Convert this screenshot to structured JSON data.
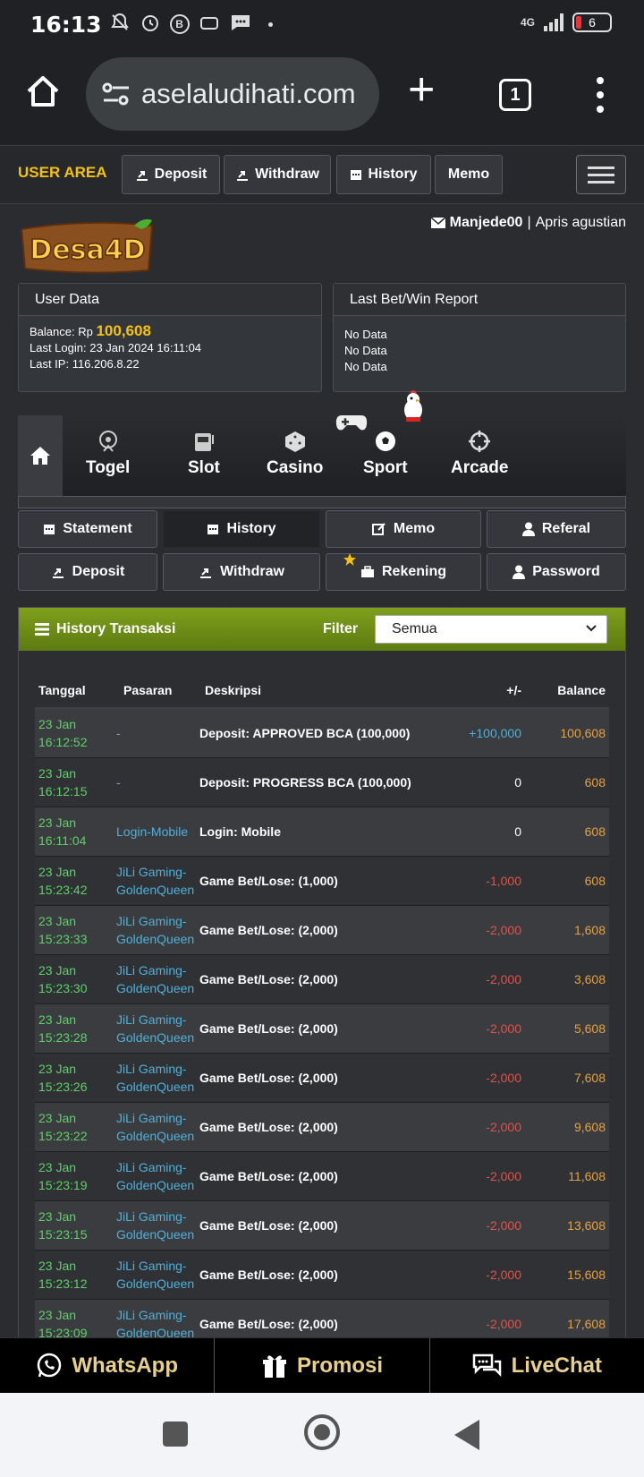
{
  "status_bar": {
    "time": "16:13",
    "network": "4G",
    "battery": "6"
  },
  "browser": {
    "url": "aselaludihati.com",
    "tab_count": "1"
  },
  "user_area": {
    "title": "USER AREA",
    "buttons": [
      "Deposit",
      "Withdraw",
      "History",
      "Memo"
    ]
  },
  "logo_text": "Desa4D",
  "user": {
    "username": "Manjede00",
    "separator": "|",
    "name": "Apris agustian"
  },
  "user_data": {
    "title": "User Data",
    "balance_label": "Balance: Rp",
    "balance_value": "100,608",
    "last_login": "Last Login: 23 Jan 2024 16:11:04",
    "last_ip": "Last IP: 116.206.8.22"
  },
  "last_bet": {
    "title": "Last Bet/Win Report",
    "lines": [
      "No Data",
      "No Data",
      "No Data"
    ]
  },
  "games": [
    "Togel",
    "Slot",
    "Casino",
    "Sport",
    "Arcade"
  ],
  "sub_buttons": {
    "row1": [
      "Statement",
      "History",
      "Memo",
      "Referal"
    ],
    "row2": [
      "Deposit",
      "Withdraw",
      "Rekening",
      "Password"
    ]
  },
  "history": {
    "title": "History Transaksi",
    "filter_label": "Filter",
    "filter_value": "Semua",
    "columns": [
      "Tanggal",
      "Pasaran",
      "Deskripsi",
      "+/-",
      "Balance"
    ],
    "rows": [
      {
        "date": "23 Jan",
        "time": "16:12:52",
        "pas1": "-",
        "pas2": "",
        "desc": "Deposit: APPROVED BCA (100,000)",
        "amt": "+100,000",
        "bal": "100,608"
      },
      {
        "date": "23 Jan",
        "time": "16:12:15",
        "pas1": "-",
        "pas2": "",
        "desc": "Deposit: PROGRESS BCA (100,000)",
        "amt": "0",
        "bal": "608"
      },
      {
        "date": "23 Jan",
        "time": "16:11:04",
        "pas1": "Login-Mobile",
        "pas2": "",
        "desc": "Login: Mobile",
        "amt": "0",
        "bal": "608"
      },
      {
        "date": "23 Jan",
        "time": "15:23:42",
        "pas1": "JiLi Gaming-",
        "pas2": "GoldenQueen",
        "desc": "Game Bet/Lose: (1,000)",
        "amt": "-1,000",
        "bal": "608"
      },
      {
        "date": "23 Jan",
        "time": "15:23:33",
        "pas1": "JiLi Gaming-",
        "pas2": "GoldenQueen",
        "desc": "Game Bet/Lose: (2,000)",
        "amt": "-2,000",
        "bal": "1,608"
      },
      {
        "date": "23 Jan",
        "time": "15:23:30",
        "pas1": "JiLi Gaming-",
        "pas2": "GoldenQueen",
        "desc": "Game Bet/Lose: (2,000)",
        "amt": "-2,000",
        "bal": "3,608"
      },
      {
        "date": "23 Jan",
        "time": "15:23:28",
        "pas1": "JiLi Gaming-",
        "pas2": "GoldenQueen",
        "desc": "Game Bet/Lose: (2,000)",
        "amt": "-2,000",
        "bal": "5,608"
      },
      {
        "date": "23 Jan",
        "time": "15:23:26",
        "pas1": "JiLi Gaming-",
        "pas2": "GoldenQueen",
        "desc": "Game Bet/Lose: (2,000)",
        "amt": "-2,000",
        "bal": "7,608"
      },
      {
        "date": "23 Jan",
        "time": "15:23:22",
        "pas1": "JiLi Gaming-",
        "pas2": "GoldenQueen",
        "desc": "Game Bet/Lose: (2,000)",
        "amt": "-2,000",
        "bal": "9,608"
      },
      {
        "date": "23 Jan",
        "time": "15:23:19",
        "pas1": "JiLi Gaming-",
        "pas2": "GoldenQueen",
        "desc": "Game Bet/Lose: (2,000)",
        "amt": "-2,000",
        "bal": "11,608"
      },
      {
        "date": "23 Jan",
        "time": "15:23:15",
        "pas1": "JiLi Gaming-",
        "pas2": "GoldenQueen",
        "desc": "Game Bet/Lose: (2,000)",
        "amt": "-2,000",
        "bal": "13,608"
      },
      {
        "date": "23 Jan",
        "time": "15:23:12",
        "pas1": "JiLi Gaming-",
        "pas2": "GoldenQueen",
        "desc": "Game Bet/Lose: (2,000)",
        "amt": "-2,000",
        "bal": "15,608"
      },
      {
        "date": "23 Jan",
        "time": "15:23:09",
        "pas1": "JiLi Gaming-",
        "pas2": "GoldenQueen",
        "desc": "Game Bet/Lose: (2,000)",
        "amt": "-2,000",
        "bal": "17,608"
      }
    ]
  },
  "bottom_bar": [
    "WhatsApp",
    "Promosi",
    "LiveChat"
  ],
  "colors": {
    "accent_yellow": "#f4c20d",
    "green_header": "#7fa01c",
    "positive": "#4fb0d8",
    "negative": "#e0524a",
    "balance": "#e8a13a"
  }
}
